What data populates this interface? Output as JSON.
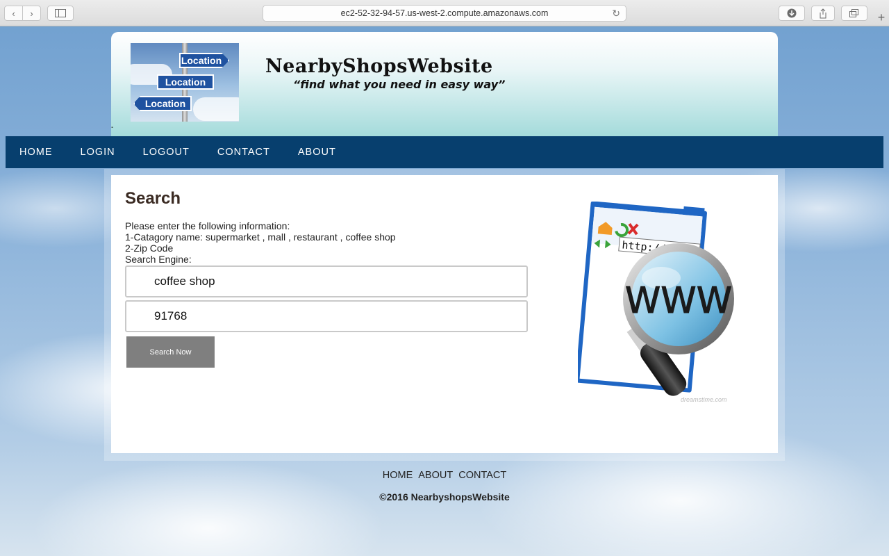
{
  "browser": {
    "url": "ec2-52-32-94-57.us-west-2.compute.amazonaws.com"
  },
  "header": {
    "logo_signs": [
      "Location",
      "Location",
      "Location"
    ],
    "site_title": "NearbyShopsWebsite",
    "tagline": "“find what you need in easy way”"
  },
  "nav": {
    "items": [
      "HOME",
      "LOGIN",
      "LOGOUT",
      "CONTACT",
      "ABOUT"
    ]
  },
  "main": {
    "title": "Search",
    "instructions": [
      "Please enter the following information:",
      "1-Catagory name: supermarket , mall , restaurant , coffee shop",
      "2-Zip Code",
      "Search Engine:"
    ],
    "category_value": "coffee shop",
    "zip_value": "91768",
    "button_label": "Search Now",
    "illustration": {
      "url_text": "http://",
      "lens_text": "WWW",
      "watermark": "dreamstime.com"
    }
  },
  "footer": {
    "links": [
      "HOME",
      "ABOUT",
      "CONTACT"
    ],
    "copyright": "©2016 NearbyshopsWebsite"
  },
  "colors": {
    "nav_bg": "#073f6e",
    "button_bg": "#7f7f7f",
    "header_gradient_end": "#a4dbdb"
  }
}
